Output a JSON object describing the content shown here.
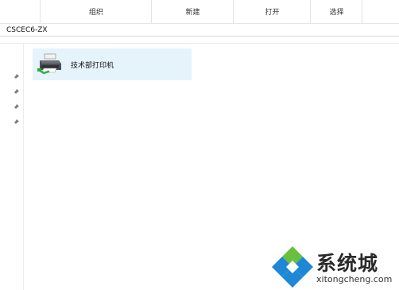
{
  "ribbon": {
    "groups": [
      "组织",
      "新建",
      "打开",
      "选择"
    ]
  },
  "address": {
    "path": "CSCEC6-ZX"
  },
  "nav": {
    "pins": [
      "pin-icon",
      "pin-icon",
      "pin-icon",
      "pin-icon"
    ]
  },
  "content": {
    "items": [
      {
        "label": "技术部打印机",
        "icon": "printer-icon",
        "selected": true
      }
    ]
  },
  "watermark": {
    "brand": "系统城",
    "url": "xitongcheng.com"
  },
  "colors": {
    "selection": "#e5f3fb",
    "watermark_blue": "#1e88d6",
    "watermark_green": "#6abf3f"
  }
}
